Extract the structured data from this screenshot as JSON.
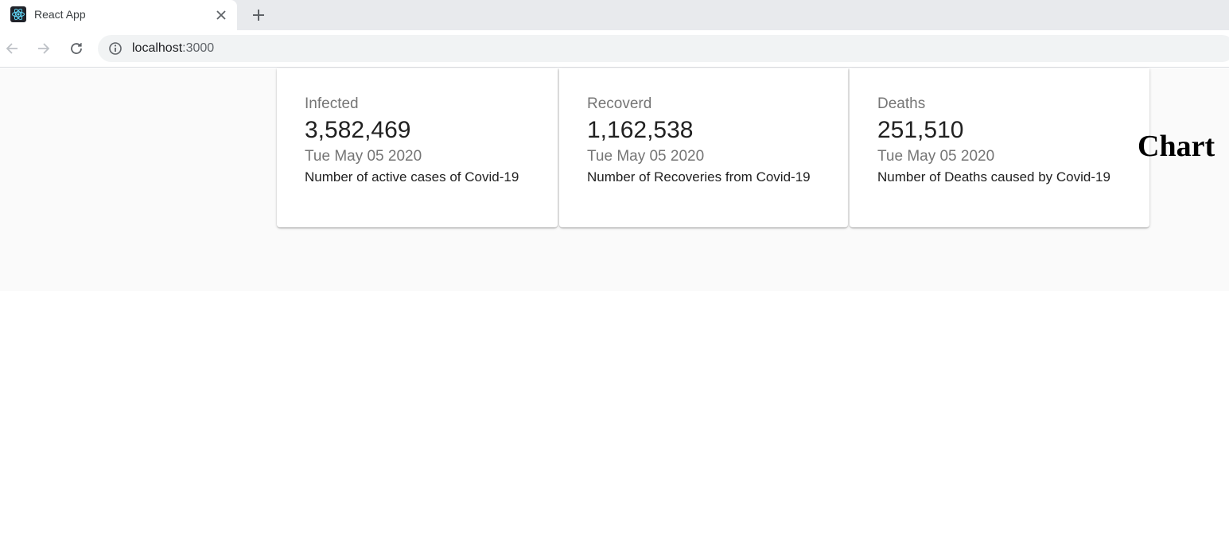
{
  "browser": {
    "tab": {
      "title": "React App",
      "favicon": "react-logo-icon"
    },
    "address": {
      "host": "localhost",
      "port": ":3000"
    }
  },
  "cards": [
    {
      "label": "Infected",
      "value": "3,582,469",
      "date": "Tue May 05 2020",
      "description": "Number of active cases of Covid-19"
    },
    {
      "label": "Recoverd",
      "value": "1,162,538",
      "date": "Tue May 05 2020",
      "description": "Number of Recoveries from Covid-19"
    },
    {
      "label": "Deaths",
      "value": "251,510",
      "date": "Tue May 05 2020",
      "description": "Number of Deaths caused by Covid-19"
    }
  ],
  "chart": {
    "heading": "Chart"
  }
}
